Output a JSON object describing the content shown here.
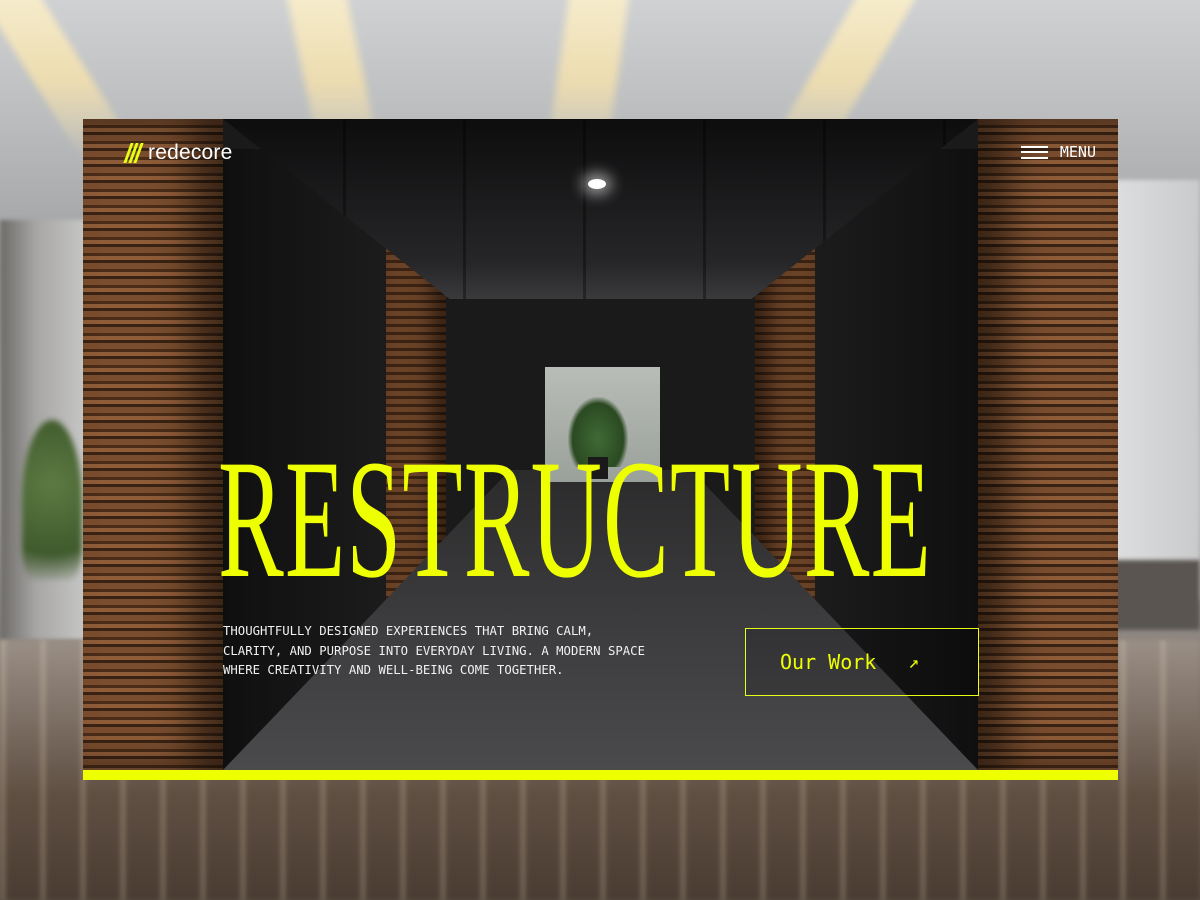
{
  "brand": {
    "name": "redecore",
    "accent": "#eeff00"
  },
  "nav": {
    "menu_label": "MENU"
  },
  "hero": {
    "headline": "RESTRUCTURE",
    "description": "THOUGHTFULLY DESIGNED EXPERIENCES THAT BRING CALM, CLARITY, AND PURPOSE INTO EVERYDAY LIVING. A MODERN SPACE WHERE CREATIVITY AND WELL-BEING COME TOGETHER.",
    "cta_label": "Our Work",
    "cta_icon": "arrow-up-right-icon"
  }
}
